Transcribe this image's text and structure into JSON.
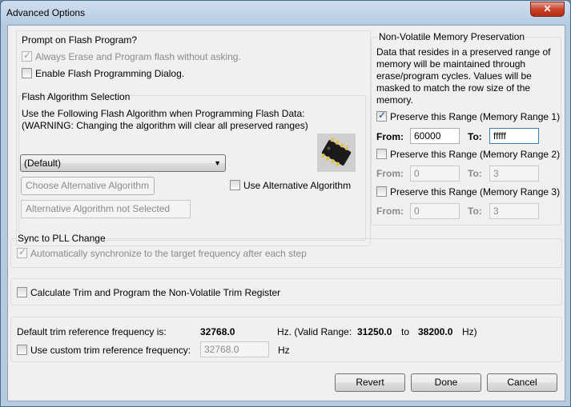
{
  "window": {
    "title": "Advanced Options",
    "close_label": "✕"
  },
  "prompt": {
    "heading": "Prompt on Flash Program?",
    "always_erase": {
      "label": "Always Erase and Program flash without asking.",
      "checked": true,
      "enabled": false
    },
    "enable_dialog": {
      "label": "Enable Flash Programming Dialog.",
      "checked": false
    }
  },
  "algorithm": {
    "heading": "Flash Algorithm Selection",
    "desc_line1": "Use the Following Flash Algorithm when Programming Flash Data:",
    "desc_line2": "(WARNING: Changing the algorithm will clear all preserved ranges)",
    "select_value": "(Default)",
    "choose_button": "Choose Alternative Algorithm",
    "use_alt_label": "Use Alternative Algorithm",
    "status_text": "Alternative Algorithm not Selected"
  },
  "nvm": {
    "heading": "Non-Volatile Memory Preservation",
    "description": "Data that resides in a preserved range of memory will be maintained through erase/program cycles. Values will be masked to match the row size of the memory.",
    "from_label": "From:",
    "to_label": "To:",
    "ranges": [
      {
        "label": "Preserve this Range (Memory Range 1)",
        "checked": true,
        "from": "60000",
        "to": "fffff"
      },
      {
        "label": "Preserve this Range (Memory Range 2)",
        "checked": false,
        "from": "0",
        "to": "3"
      },
      {
        "label": "Preserve this Range (Memory Range 3)",
        "checked": false,
        "from": "0",
        "to": "3"
      }
    ]
  },
  "pll": {
    "heading": "Sync to PLL Change",
    "auto_sync_label": "Automatically synchronize to the target frequency after each step"
  },
  "trim": {
    "calc_label": "Calculate Trim and Program the Non-Volatile Trim Register",
    "default_label": "Default trim reference frequency is:",
    "default_value": "32768.0",
    "hz_valid_prefix": "Hz. (Valid Range:",
    "range_min": "31250.0",
    "to_word": "to",
    "range_max": "38200.0",
    "hz_close": "Hz)",
    "custom_label": "Use custom trim reference frequency:",
    "custom_value": "32768.0",
    "hz_unit": "Hz"
  },
  "buttons": {
    "revert": "Revert",
    "done": "Done",
    "cancel": "Cancel"
  }
}
